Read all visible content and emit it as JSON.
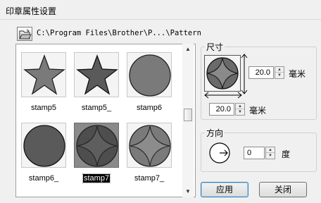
{
  "window": {
    "title": "印章属性设置"
  },
  "toolbar": {
    "folder_icon": "open-folder-icon",
    "path": "C:\\Program Files\\Brother\\P...\\Pattern"
  },
  "stamps": [
    {
      "label": "stamp5",
      "shape": "star-outline",
      "selected": false
    },
    {
      "label": "stamp5_",
      "shape": "star-filled",
      "selected": false
    },
    {
      "label": "stamp6",
      "shape": "circle-outline",
      "selected": false
    },
    {
      "label": "stamp6_",
      "shape": "circle-filled",
      "selected": false
    },
    {
      "label": "stamp7",
      "shape": "astroid-filled",
      "selected": true
    },
    {
      "label": "stamp7_",
      "shape": "astroid-outline",
      "selected": false
    }
  ],
  "size": {
    "title": "尺寸",
    "height_value": "20.0",
    "height_unit": "毫米",
    "width_value": "20.0",
    "width_unit": "毫米"
  },
  "direction": {
    "title": "方向",
    "angle_value": "0",
    "angle_unit": "度"
  },
  "buttons": {
    "apply": "应用",
    "close": "关闭"
  },
  "colors": {
    "shape_fill": "#6d6d6d",
    "selected_bg": "#8a8a8a",
    "accent": "#3c7fb1"
  }
}
